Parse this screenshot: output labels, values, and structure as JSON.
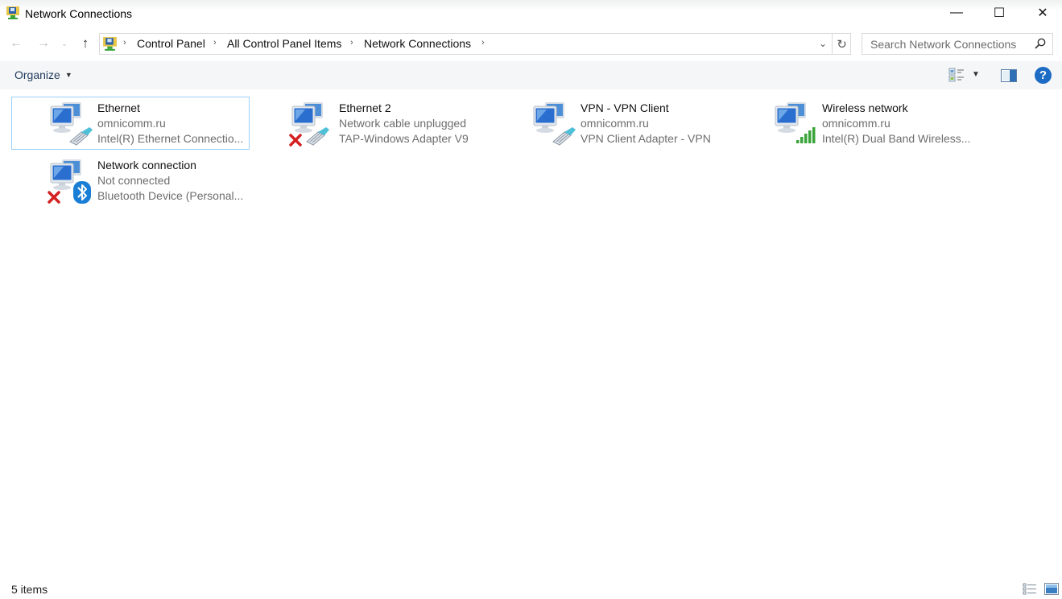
{
  "window": {
    "title": "Network Connections",
    "controls": {
      "minimize": "—",
      "maximize": "☐",
      "close": "✕"
    }
  },
  "navigation": {
    "back": "←",
    "forward": "→",
    "recent": "⌄",
    "up": "↑",
    "breadcrumb": [
      "Control Panel",
      "All Control Panel Items",
      "Network Connections"
    ],
    "separator": "›",
    "dropdown": "⌄",
    "refresh": "↻"
  },
  "search": {
    "placeholder": "Search Network Connections",
    "value": ""
  },
  "toolbar": {
    "organize_label": "Organize",
    "caret": "▼",
    "views_caret": "▼",
    "help": "?"
  },
  "connections": [
    {
      "name": "Ethernet",
      "status": "omnicomm.ru",
      "device": "Intel(R) Ethernet Connectio...",
      "type": "ethernet",
      "disabled": false,
      "selected": true
    },
    {
      "name": "Ethernet 2",
      "status": "Network cable unplugged",
      "device": "TAP-Windows Adapter V9",
      "type": "ethernet",
      "disabled": true,
      "selected": false
    },
    {
      "name": "VPN - VPN Client",
      "status": "omnicomm.ru",
      "device": "VPN Client Adapter - VPN",
      "type": "ethernet",
      "disabled": false,
      "selected": false
    },
    {
      "name": "Wireless network",
      "status": "omnicomm.ru",
      "device": "Intel(R) Dual Band Wireless...",
      "type": "wireless",
      "disabled": false,
      "selected": false
    },
    {
      "name": "Network connection",
      "status": "Not connected",
      "device": "Bluetooth Device (Personal...",
      "type": "bluetooth",
      "disabled": true,
      "selected": false
    }
  ],
  "statusbar": {
    "item_count": "5 items"
  },
  "colors": {
    "selection_border": "#99d1ff",
    "help_blue": "#1c6bc4",
    "signal_green": "#3aa33a",
    "error_red": "#d42020",
    "bluetooth_blue": "#1a7ed6"
  }
}
